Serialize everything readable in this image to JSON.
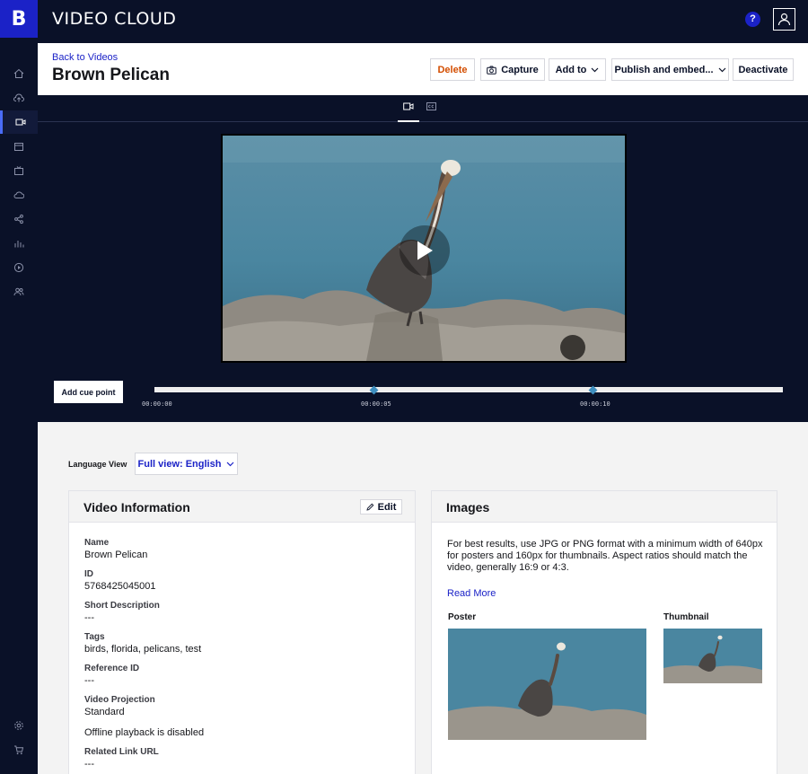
{
  "app": {
    "logo_text": "B",
    "title": "VIDEO CLOUD",
    "help_label": "?"
  },
  "sidebar": {
    "items": [
      {
        "icon": "home-icon"
      },
      {
        "icon": "upload-icon"
      },
      {
        "icon": "video-icon",
        "active": true
      },
      {
        "icon": "media-icon"
      },
      {
        "icon": "live-icon"
      },
      {
        "icon": "cloud-icon"
      },
      {
        "icon": "share-icon"
      },
      {
        "icon": "analytics-icon"
      },
      {
        "icon": "players-icon"
      },
      {
        "icon": "users-icon"
      },
      {
        "icon": "settings-icon"
      },
      {
        "icon": "cart-icon"
      }
    ]
  },
  "header": {
    "back_link": "Back to Videos",
    "title": "Brown Pelican",
    "buttons": {
      "delete": "Delete",
      "capture": "Capture",
      "add_to": "Add to",
      "publish": "Publish and embed...",
      "deactivate": "Deactivate"
    }
  },
  "player": {
    "tabs": [
      "video-tab",
      "captions-tab"
    ],
    "cue_button": "Add cue point",
    "timeline": {
      "labels": [
        "00:00:00",
        "00:00:05",
        "00:00:10"
      ],
      "cue_points": [
        "00:00:05",
        "00:00:10"
      ]
    }
  },
  "language": {
    "label": "Language View",
    "selected": "Full view: English"
  },
  "video_info": {
    "title": "Video Information",
    "edit_label": "Edit",
    "fields": {
      "name_label": "Name",
      "name_value": "Brown Pelican",
      "id_label": "ID",
      "id_value": "5768425045001",
      "short_desc_label": "Short Description",
      "short_desc_value": "---",
      "tags_label": "Tags",
      "tags_value": "birds, florida, pelicans, test",
      "reference_id_label": "Reference ID",
      "reference_id_value": "---",
      "projection_label": "Video Projection",
      "projection_value": "Standard",
      "offline_value": "Offline playback is disabled",
      "related_link_label": "Related Link URL",
      "related_link_value": "---"
    }
  },
  "images": {
    "title": "Images",
    "description": "For best results, use JPG or PNG format with a minimum width of 640px for posters and 160px for thumbnails. Aspect ratios should match the video, generally 16:9 or 4:3.",
    "read_more": "Read More",
    "poster_label": "Poster",
    "thumbnail_label": "Thumbnail"
  },
  "colors": {
    "nav_bg": "#0a1128",
    "brand": "#1b22c7",
    "delete": "#d34d00",
    "cue_marker": "#3f8fc0"
  }
}
